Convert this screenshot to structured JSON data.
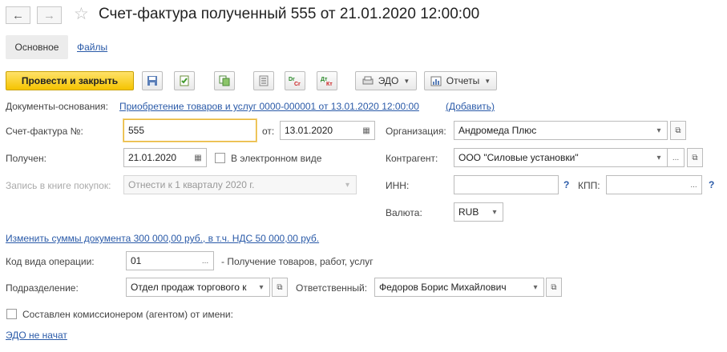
{
  "window": {
    "title": "Счет-фактура полученный 555 от 21.01.2020 12:00:00"
  },
  "nav": {
    "back": "←",
    "forward": "→",
    "star": "☆"
  },
  "tabs": {
    "main": "Основное",
    "files": "Файлы"
  },
  "toolbar": {
    "post_close": "Провести и закрыть",
    "edo": "ЭДО",
    "reports": "Отчеты"
  },
  "basis": {
    "label": "Документы-основания:",
    "link": "Приобретение товаров и услуг 0000-000001 от 13.01.2020 12:00:00",
    "add": "(Добавить)"
  },
  "invoice": {
    "label": "Счет-фактура №:",
    "value": "555",
    "date_label": "от:",
    "date": "13.01.2020"
  },
  "received": {
    "label": "Получен:",
    "date": "21.01.2020",
    "electronic_label": "В электронном виде"
  },
  "book": {
    "label": "Запись в книге покупок:",
    "value": "Отнести к 1 кварталу 2020 г."
  },
  "org": {
    "label": "Организация:",
    "value": "Андромеда Плюс"
  },
  "contractor": {
    "label": "Контрагент:",
    "value": "ООО \"Силовые установки\""
  },
  "inn": {
    "label": "ИНН:",
    "value": "",
    "q": "?"
  },
  "kpp": {
    "label": "КПП:",
    "value": "",
    "q": "?"
  },
  "currency": {
    "label": "Валюта:",
    "value": "RUB"
  },
  "change_sums": {
    "link": "Изменить суммы документа 300 000,00 руб., в т.ч. НДС 50 000,00 руб."
  },
  "op_code": {
    "label": "Код вида операции:",
    "value": "01",
    "desc": "- Получение товаров, работ, услуг"
  },
  "division": {
    "label": "Подразделение:",
    "value": "Отдел продаж торгового к"
  },
  "responsible": {
    "label": "Ответственный:",
    "value": "Федоров Борис Михайлович"
  },
  "commissioner": {
    "label": "Составлен комиссионером (агентом) от имени:"
  },
  "edo_status": {
    "link": "ЭДО не начат"
  },
  "glyphs": {
    "dots": "...",
    "open": "⧉",
    "arrow": "▾",
    "calendar": "▦"
  }
}
